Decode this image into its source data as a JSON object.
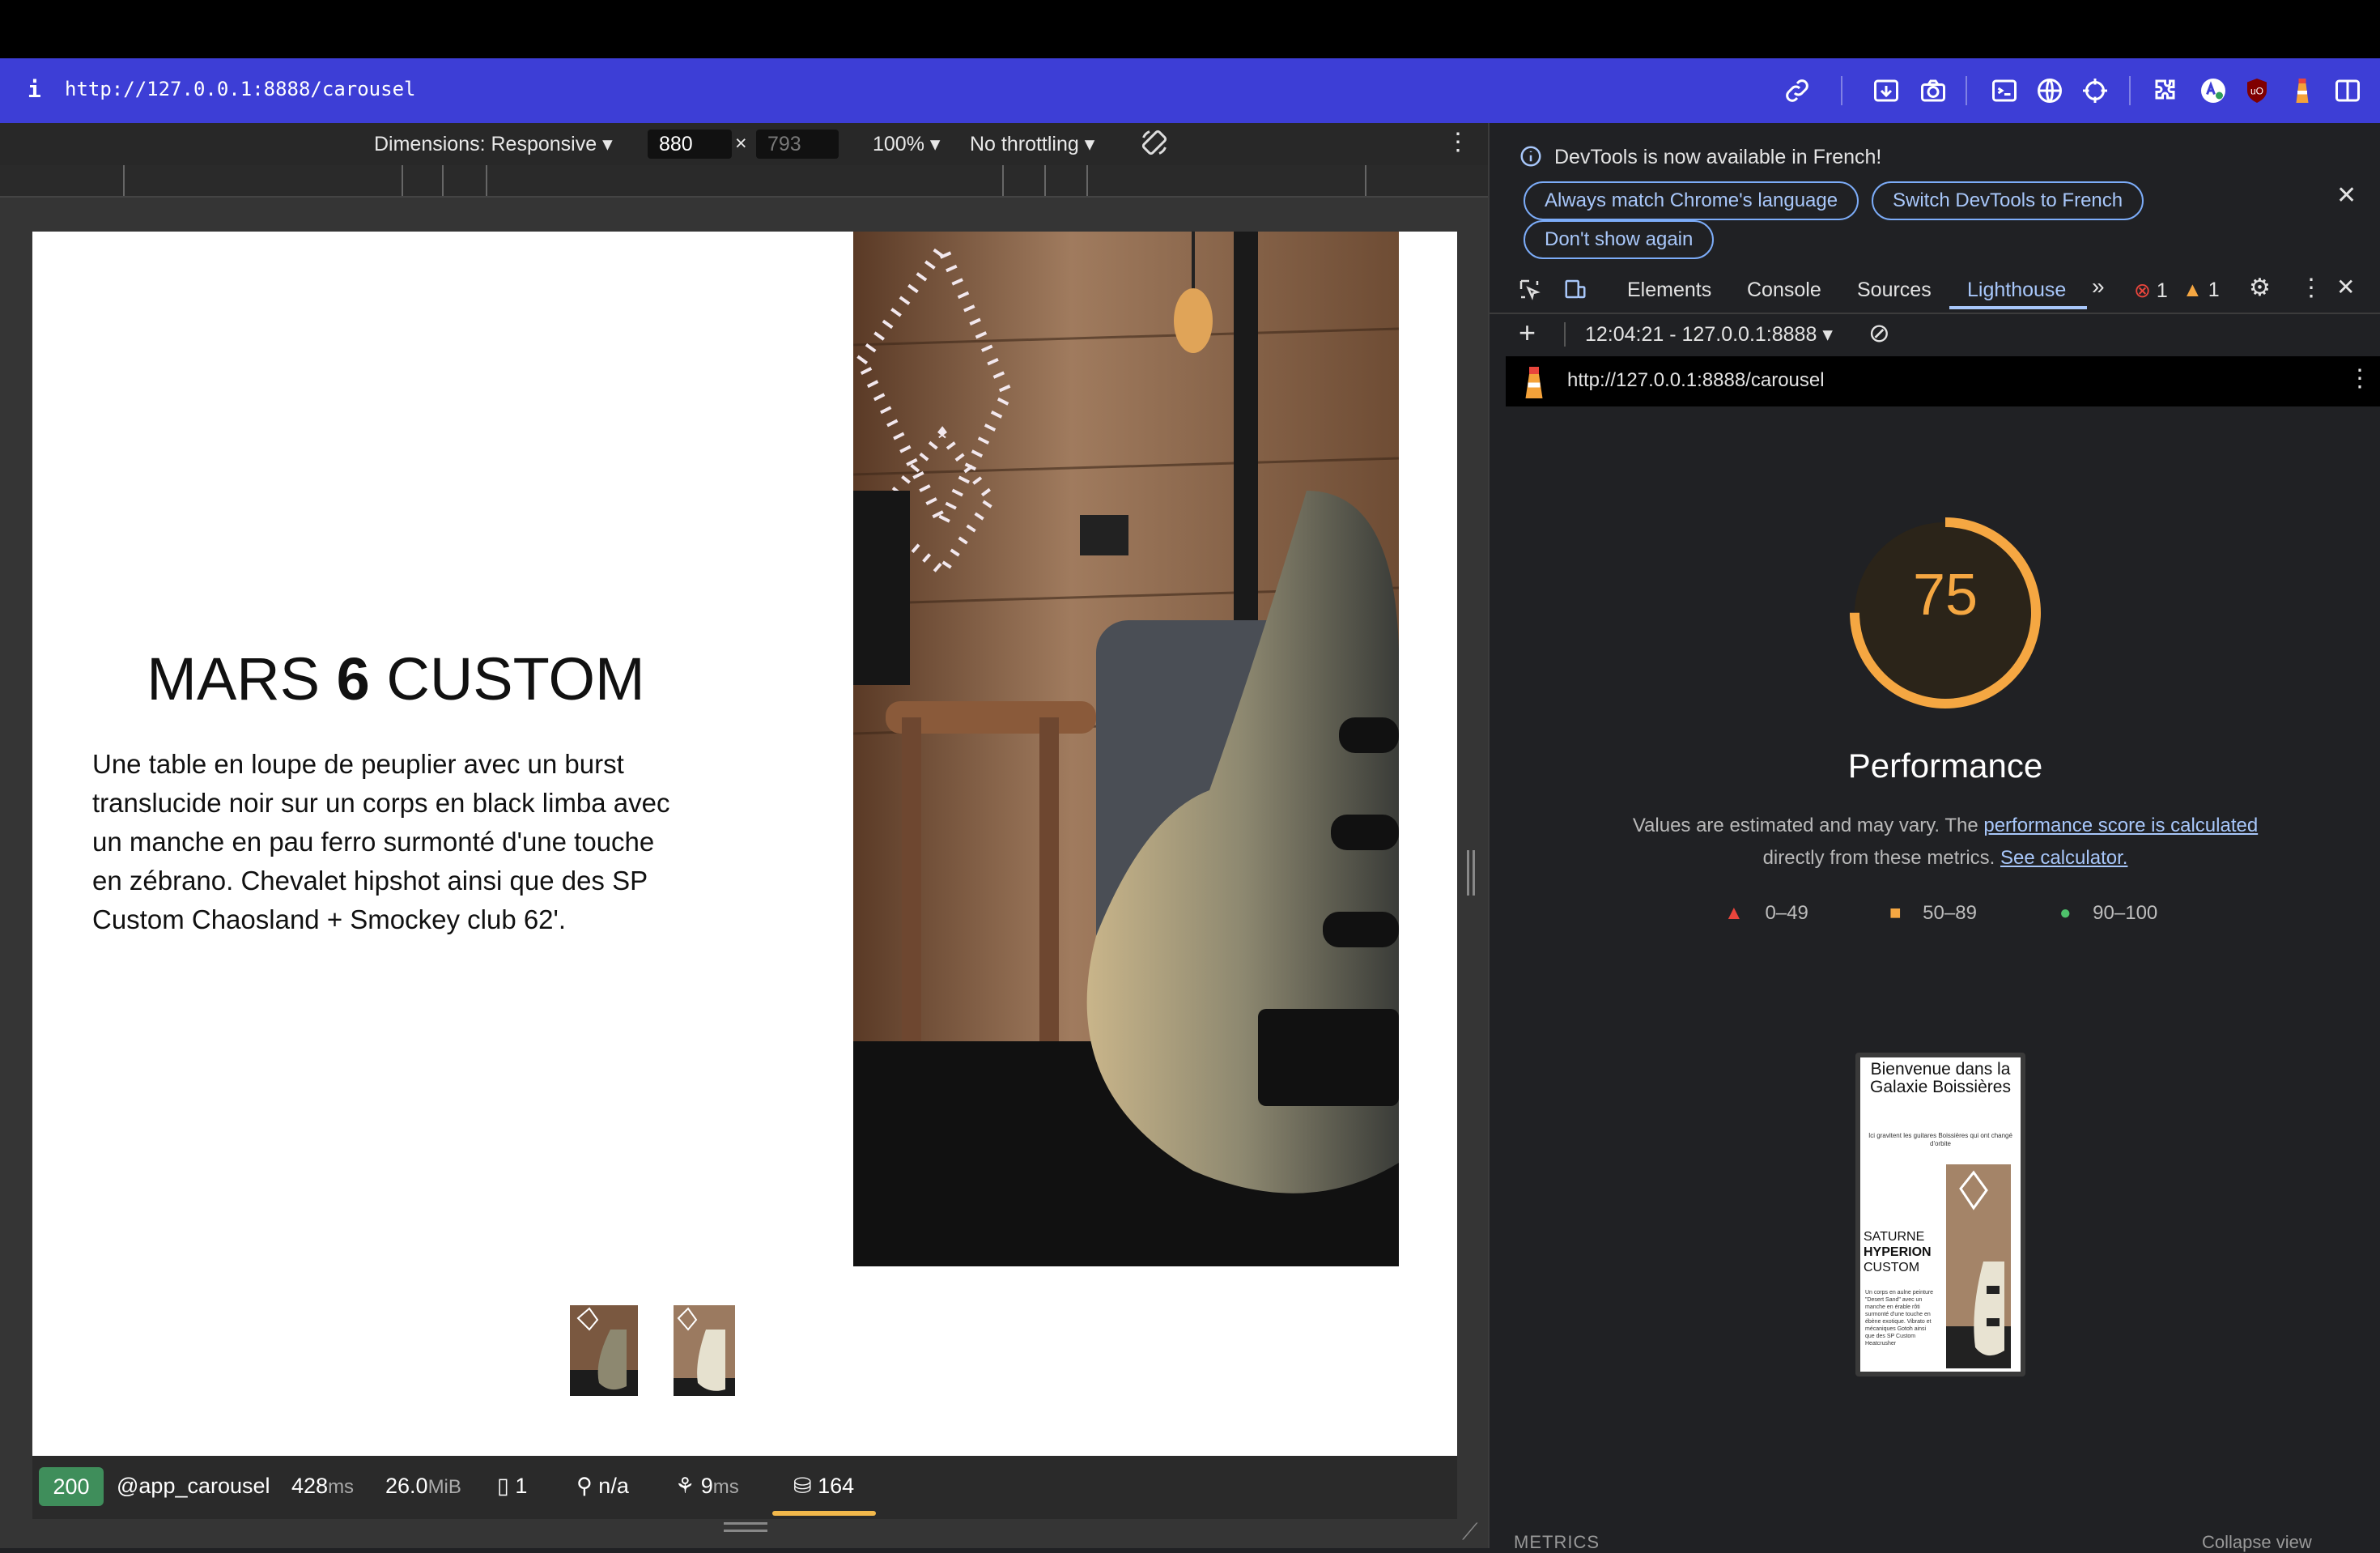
{
  "browser": {
    "info_glyph": "i",
    "url": "http://127.0.0.1:8888/carousel"
  },
  "device_toolbar": {
    "dimensions_label": "Dimensions: Responsive",
    "width": "880",
    "times": "×",
    "height": "793",
    "zoom": "100%",
    "throttling": "No throttling"
  },
  "page": {
    "title_pre": "MARS ",
    "title_bold": "6",
    "title_post": " CUSTOM",
    "description": "Une table en loupe de peuplier avec un burst translucide noir sur un corps en black limba avec un manche en pau ferro surmonté d'une touche en zébrano. Chevalet hipshot ainsi que des SP Custom Chaosland + Smockey club 62'."
  },
  "debug_bar": {
    "status": "200",
    "route": "@app_carousel",
    "time_value": "428",
    "time_unit": "ms",
    "memory_value": "26.0",
    "memory_unit": "MiB",
    "forms": "1",
    "user": "n/a",
    "twig_value": "9",
    "twig_unit": "ms",
    "db_queries": "164"
  },
  "devtools": {
    "notice": "DevTools is now available in French!",
    "btn_match": "Always match Chrome's language",
    "btn_switch": "Switch DevTools to French",
    "btn_dont_show": "Don't show again",
    "tabs": [
      "Elements",
      "Console",
      "Sources",
      "Lighthouse"
    ],
    "errors": "1",
    "warnings": "1",
    "report_selector": "12:04:21 - 127.0.0.1:8888",
    "report_url": "http://127.0.0.1:8888/carousel"
  },
  "lighthouse": {
    "score": "75",
    "score_fraction": 0.75,
    "category": "Performance",
    "note_pre": "Values are estimated and may vary. The ",
    "note_link1": "performance score is calculated",
    "note_mid": "directly from these metrics.",
    "note_link2": "See calculator.",
    "legend": [
      "0–49",
      "50–89",
      "90–100"
    ],
    "colors": {
      "fail": "#e8453c",
      "average": "#f5a742",
      "pass": "#4ec26b"
    },
    "metrics_header": "METRICS",
    "collapse": "Collapse view"
  },
  "preview": {
    "heading": "Bienvenue dans la Galaxie Boissières",
    "subheading": "Ici gravitent les guitares Boissières qui ont changé d'orbite",
    "title_pre": "SATURNE",
    "title_bold": "HYPERION",
    "title_post": "CUSTOM",
    "description": "Un corps en aulne peinture \"Desert Sand\" avec un manche en érable rôti surmonté d'une touche en ébène exotique. Vibrato et mécaniques Gotoh ainsi que des SP Custom Heatcrusher"
  }
}
